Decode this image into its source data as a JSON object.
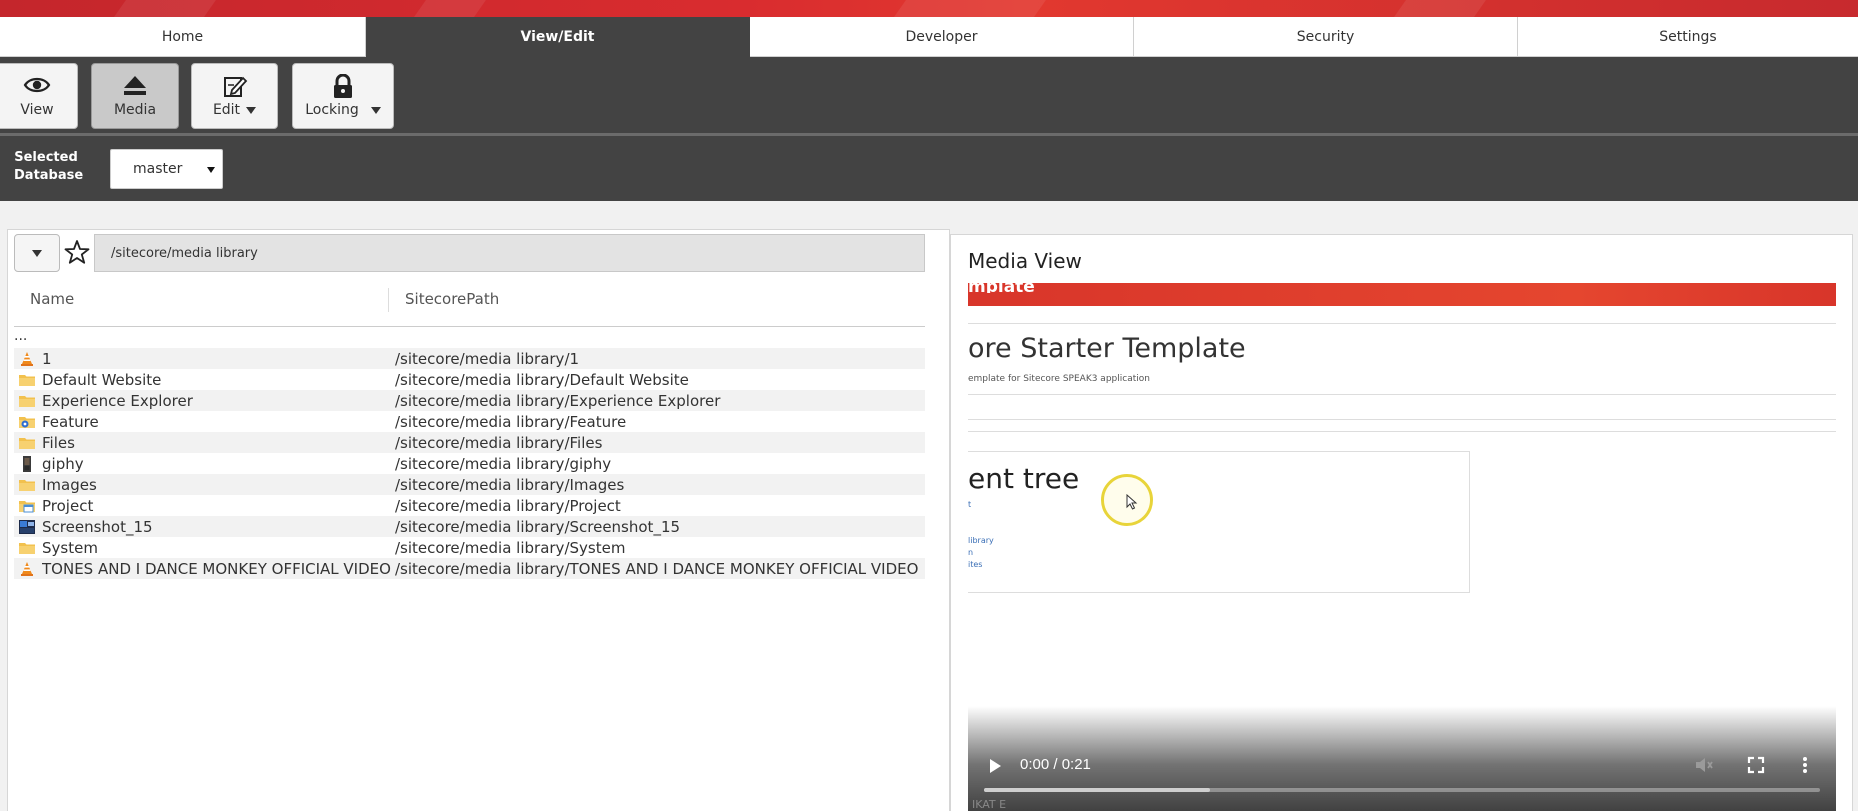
{
  "tabs": [
    {
      "label": "Home"
    },
    {
      "label": "View/Edit"
    },
    {
      "label": "Developer"
    },
    {
      "label": "Security"
    },
    {
      "label": "Settings"
    }
  ],
  "active_tab": "View/Edit",
  "ribbon": {
    "view_label": "View",
    "media_label": "Media",
    "edit_label": "Edit",
    "locking_label": "Locking"
  },
  "db": {
    "label": "Selected Database",
    "value": "master"
  },
  "left": {
    "path": "/sitecore/media library",
    "col_name": "Name",
    "col_path": "SitecorePath",
    "parent": "...",
    "rows": [
      {
        "icon": "vlc-cone-icon",
        "name": "1",
        "path": "/sitecore/media library/1"
      },
      {
        "icon": "folder-icon",
        "name": "Default Website",
        "path": "/sitecore/media library/Default Website"
      },
      {
        "icon": "folder-icon",
        "name": "Experience Explorer",
        "path": "/sitecore/media library/Experience Explorer"
      },
      {
        "icon": "feature-folder-icon",
        "name": "Feature",
        "path": "/sitecore/media library/Feature"
      },
      {
        "icon": "folder-icon",
        "name": "Files",
        "path": "/sitecore/media library/Files"
      },
      {
        "icon": "image-thumb-icon",
        "name": "giphy",
        "path": "/sitecore/media library/giphy"
      },
      {
        "icon": "folder-icon",
        "name": "Images",
        "path": "/sitecore/media library/Images"
      },
      {
        "icon": "project-folder-icon",
        "name": "Project",
        "path": "/sitecore/media library/Project"
      },
      {
        "icon": "screenshot-thumb-icon",
        "name": "Screenshot_15",
        "path": "/sitecore/media library/Screenshot_15"
      },
      {
        "icon": "folder-icon",
        "name": "System",
        "path": "/sitecore/media library/System"
      },
      {
        "icon": "vlc-cone-icon",
        "name": "TONES AND I DANCE MONKEY OFFICIAL VIDEO",
        "path": "/sitecore/media library/TONES AND I DANCE MONKEY OFFICIAL VIDEO"
      }
    ]
  },
  "media_view": {
    "title": "Media View",
    "video": {
      "banner_fragment": "mplate",
      "heading_fragment": "ore Starter Template",
      "sub_fragment": "emplate for Sitecore SPEAK3 application",
      "card_title_fragment": "ent tree",
      "card_links": [
        "t",
        "library",
        "n",
        "ites"
      ],
      "time": "0:00 / 0:21",
      "progress": 0.27,
      "bottom_fragment": "IKAT E"
    }
  },
  "colors": {
    "accent_red": "#d92c2f",
    "ribbon_dark": "#434343"
  }
}
